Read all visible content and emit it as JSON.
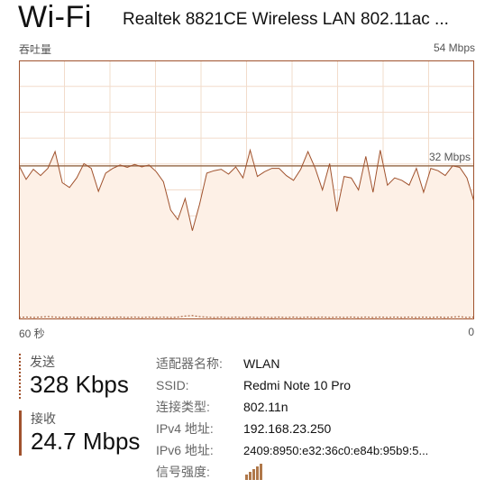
{
  "header": {
    "title": "Wi-Fi",
    "adapter": "Realtek 8821CE Wireless LAN 802.11ac ..."
  },
  "chart": {
    "ylabel": "吞吐量",
    "ymax_label": "54 Mbps",
    "ref_label": "32 Mbps",
    "x_start_label": "60 秒",
    "x_end_label": "0"
  },
  "chart_data": {
    "type": "area",
    "title": "",
    "ylabel": "吞吐量",
    "ylim": [
      0,
      54
    ],
    "xlim": [
      60,
      0
    ],
    "x_unit": "秒",
    "reference_line": 32,
    "grid": true,
    "series": [
      {
        "values": [
          32.1,
          29.2,
          31.3,
          30.0,
          31.5,
          35.0,
          28.5,
          27.5,
          29.5,
          32.5,
          31.5,
          26.7,
          30.5,
          31.5,
          32.2,
          31.7,
          32.3,
          31.8,
          32.2,
          30.8,
          28.7,
          22.8,
          20.8,
          25.2,
          18.5,
          24.0,
          30.5,
          31.0,
          31.3,
          30.3,
          31.8,
          29.5,
          35.3,
          29.8,
          30.8,
          31.5,
          31.5,
          30.0,
          29.0,
          31.3,
          35.0,
          31.5,
          27.0,
          32.5,
          22.5,
          29.8,
          29.5,
          27.0,
          34.0,
          26.5,
          35.3,
          28.0,
          29.5,
          29.0,
          28.0,
          31.5,
          26.5,
          31.5,
          31.0,
          30.0,
          32.0,
          31.7,
          29.5,
          24.5
        ],
        "color": "#a0522d"
      },
      {
        "values": [
          0.2,
          0.3,
          0.2,
          0.3,
          0.4,
          0.3,
          0.2,
          0.3,
          0.2,
          0.3,
          0.2,
          0.2,
          0.3,
          0.2,
          0.3,
          0.2,
          0.3,
          0.2,
          0.3,
          0.2,
          0.3,
          0.2,
          0.3,
          0.5,
          0.6,
          0.4,
          0.3,
          0.2,
          0.3,
          0.2,
          0.3,
          0.2,
          0.3,
          0.2,
          0.3,
          0.2,
          0.3,
          0.2,
          0.3,
          0.2,
          0.3,
          0.2,
          0.3,
          0.2,
          0.3,
          0.2,
          0.3,
          0.2,
          0.3,
          0.2,
          0.3,
          0.2,
          0.3,
          0.2,
          0.3,
          0.2,
          0.3,
          0.2,
          0.3,
          0.2,
          0.3,
          0.4,
          0.2,
          0.3
        ],
        "color": "#a0522d",
        "dashed": true
      }
    ]
  },
  "send": {
    "label": "发送",
    "value": "328 Kbps"
  },
  "receive": {
    "label": "接收",
    "value": "24.7 Mbps"
  },
  "details": {
    "adapter_name": {
      "key": "适配器名称:",
      "value": "WLAN"
    },
    "ssid": {
      "key": "SSID:",
      "value": "Redmi Note 10 Pro"
    },
    "connection_type": {
      "key": "连接类型:",
      "value": "802.11n"
    },
    "ipv4": {
      "key": "IPv4 地址:",
      "value": "192.168.23.250"
    },
    "ipv6": {
      "key": "IPv6 地址:",
      "value": "2409:8950:e32:36c0:e84b:95b9:5..."
    },
    "signal": {
      "key": "信号强度:",
      "bars": 5,
      "level": 5,
      "icon": "signal-bars-icon"
    }
  },
  "colors": {
    "accent": "#a0522d",
    "fill": "#fdf0e6",
    "grid": "#f2dccb"
  }
}
